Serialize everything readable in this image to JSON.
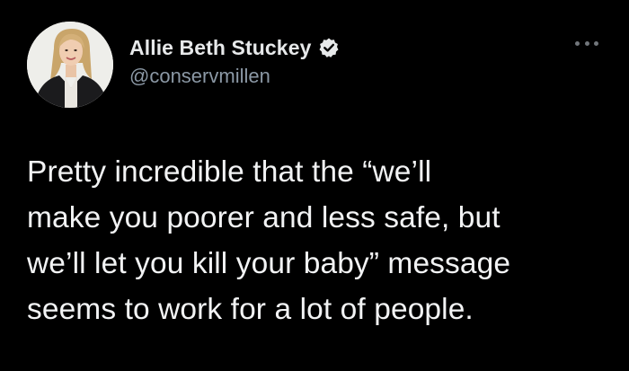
{
  "author": {
    "display_name": "Allie Beth Stuckey",
    "handle": "@conservmillen",
    "verified": true,
    "avatar_icon": "profile-photo"
  },
  "menu": {
    "icon": "more-horizontal-icon"
  },
  "tweet": {
    "lines": [
      "Pretty incredible that the “we’ll",
      "make you poorer and less safe, but",
      "we’ll let you kill your baby” message",
      "seems to work for a lot of people."
    ]
  },
  "colors": {
    "background": "#000000",
    "text": "#e7e9ea",
    "handle": "#8b98a5",
    "verified": "#e7e9ea"
  }
}
